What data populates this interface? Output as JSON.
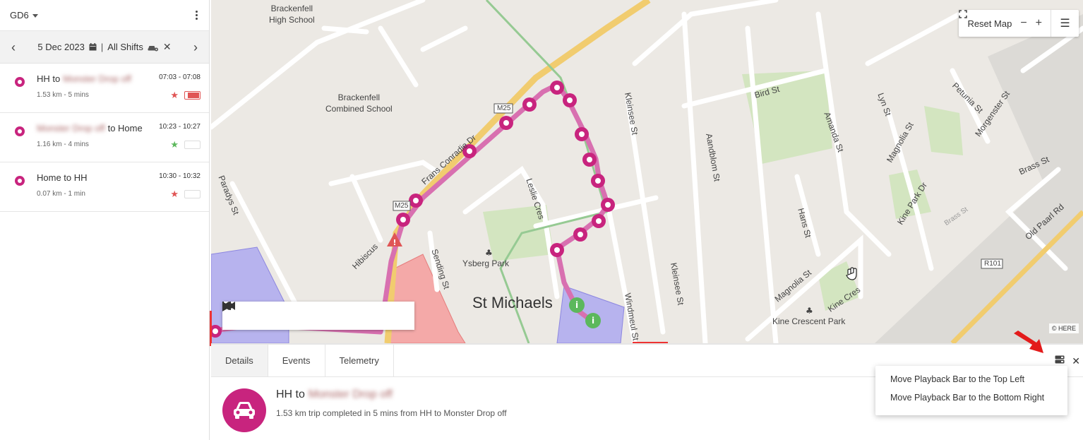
{
  "sidebar": {
    "vehicle": "GD6",
    "date": "5 Dec 2023",
    "separator": "|",
    "shift_filter": "All Shifts",
    "trips": [
      {
        "from": "HH to",
        "blurred": "Monster Drop off",
        "to": "",
        "time": "07:03 - 07:08",
        "meta": "1.53 km - 5 mins",
        "star_color": "#e05555",
        "toggle_on": true
      },
      {
        "from": "",
        "blurred": "Monster Drop off",
        "to": "to Home",
        "time": "10:23 - 10:27",
        "meta": "1.16 km - 4 mins",
        "star_color": "#5cb85c",
        "toggle_on": false
      },
      {
        "from": "Home to HH",
        "blurred": "",
        "to": "",
        "time": "10:30 - 10:32",
        "meta": "0.07 km - 1 min",
        "star_color": "#e05555",
        "toggle_on": false
      }
    ]
  },
  "map": {
    "reset_label": "Reset Map",
    "attribution": "© HERE",
    "labels": {
      "school1": "Brackenfell\nHigh School",
      "school1_a": "Brackenfell",
      "school1_b": "High School",
      "school2_a": "Brackenfell",
      "school2_b": "Combined School",
      "suburb": "St Michaels",
      "park1": "Ysberg Park",
      "park2": "Kine Crescent Park",
      "m25a": "M25",
      "m25b": "M25",
      "r101": "R101",
      "frans": "Frans Conradie Dr",
      "kleinsee1": "Kleinsee St",
      "kleinsee2": "Kleinsee St",
      "aandblom": "Aandblom St",
      "amanda": "Amanda St",
      "bird": "Bird St",
      "lyn": "Lyn St",
      "magnolia1": "Magnolia St",
      "magnolia2": "Magnolia St",
      "petunia": "Petunia St",
      "morgenster": "Morgenster St",
      "brass": "Brass St",
      "kinepark": "Kine Park Dr",
      "hans": "Hans St",
      "kinecres": "Kine Cres",
      "oldpaarl": "Old Paarl Rd",
      "windmeul": "Windmeul St",
      "leslie": "Leslie Cres",
      "sending": "Sending St",
      "hibiscus": "Hibiscus",
      "paradys": "Paradys St",
      "brassst2": "Brass St"
    }
  },
  "panel": {
    "tabs": [
      "Details",
      "Events",
      "Telemetry"
    ],
    "trip_title_prefix": "HH to",
    "trip_title_blurred": "Monster Drop off",
    "trip_description": "1.53 km trip completed in 5 mins from HH to Monster Drop off"
  },
  "dropdown": {
    "items": [
      "Move Playback Bar to the Top Left",
      "Move Playback Bar to the Bottom Right"
    ]
  },
  "colors": {
    "accent": "#c8247e",
    "route": "#d870b0",
    "danger": "#e05555",
    "success": "#5cb85c"
  }
}
